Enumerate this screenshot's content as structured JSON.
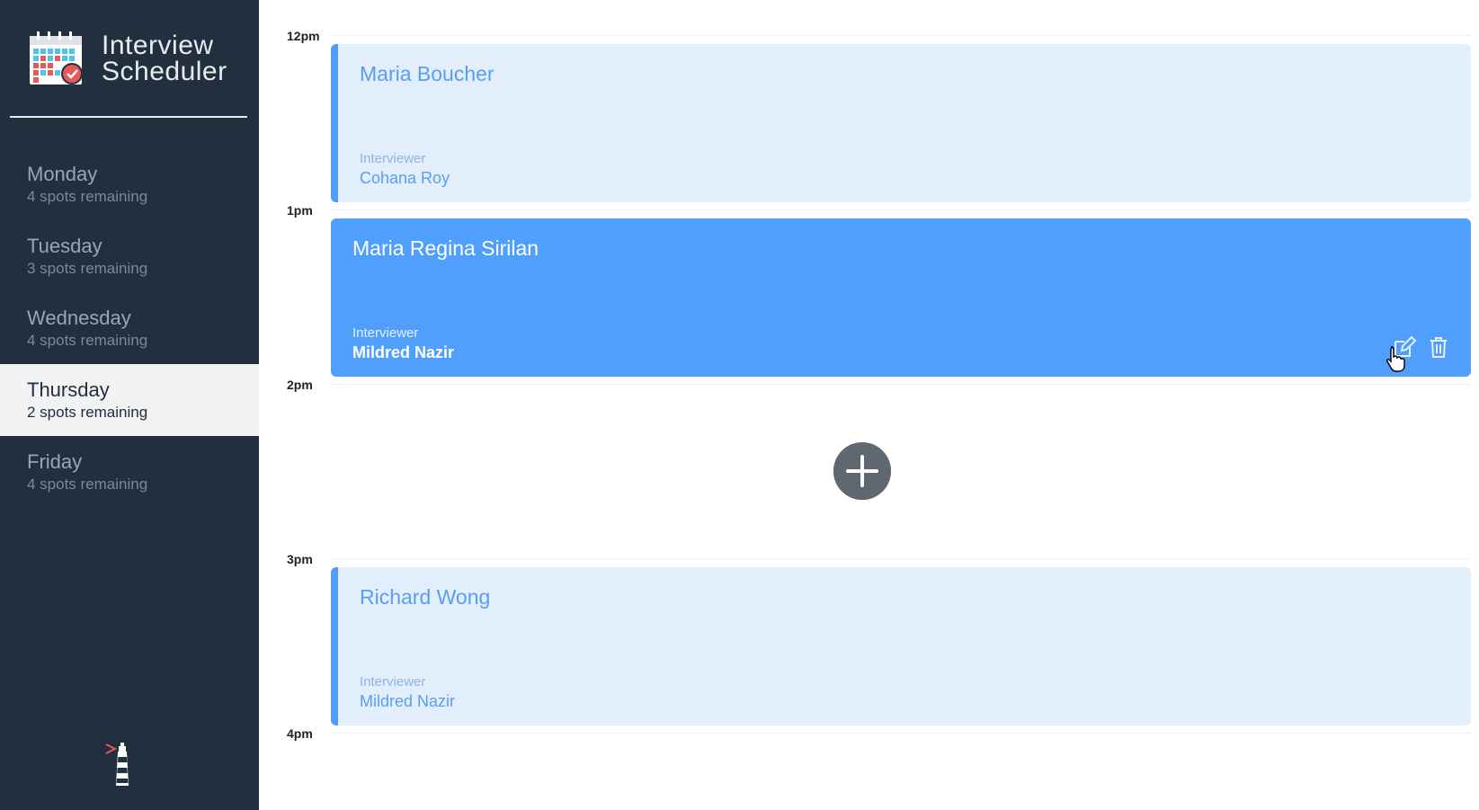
{
  "brand": {
    "line1": "Interview",
    "line2": "Scheduler"
  },
  "days": [
    {
      "name": "Monday",
      "spots": "4 spots remaining",
      "selected": false
    },
    {
      "name": "Tuesday",
      "spots": "3 spots remaining",
      "selected": false
    },
    {
      "name": "Wednesday",
      "spots": "4 spots remaining",
      "selected": false
    },
    {
      "name": "Thursday",
      "spots": "2 spots remaining",
      "selected": true
    },
    {
      "name": "Friday",
      "spots": "4 spots remaining",
      "selected": false
    }
  ],
  "times": [
    "12pm",
    "1pm",
    "2pm",
    "3pm",
    "4pm"
  ],
  "appointments": [
    {
      "student": "Maria Boucher",
      "interviewer_label": "Interviewer",
      "interviewer": "Cohana Roy"
    },
    {
      "student": "Maria Regina Sirilan",
      "interviewer_label": "Interviewer",
      "interviewer": "Mildred Nazir"
    },
    {
      "student": "Richard Wong",
      "interviewer_label": "Interviewer",
      "interviewer": "Mildred Nazir"
    }
  ],
  "icons": {
    "logo": "calendar-icon",
    "edit": "edit-icon",
    "delete": "trash-icon",
    "add": "plus-icon",
    "footer": "lighthouse-icon"
  },
  "colors": {
    "sidebar": "#222f3e",
    "accent": "#519ffd",
    "appointment_bg": "#e2eefc",
    "add_button": "#5f6770"
  }
}
